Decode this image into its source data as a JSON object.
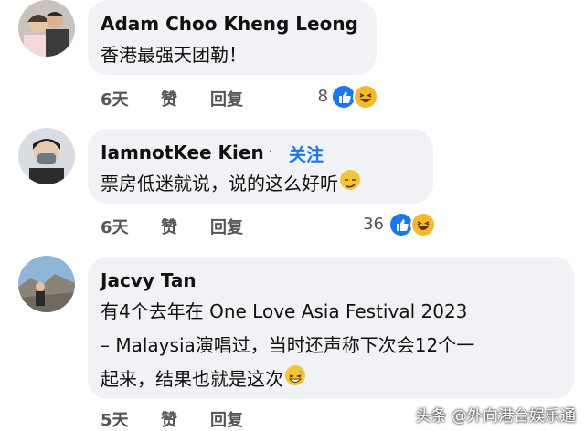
{
  "comments": [
    {
      "author": "Adam Choo Kheng Leong",
      "lines": [
        "香港最强天团勒！"
      ],
      "time": "6天",
      "like": "赞",
      "reply": "回复",
      "reaction_count": "8"
    },
    {
      "author": "IamnotKee Kien",
      "follow_dot": "·",
      "follow": "关注",
      "lines": [
        "票房低迷就说，说的这么好听"
      ],
      "time": "6天",
      "like": "赞",
      "reply": "回复",
      "reaction_count": "36"
    },
    {
      "author": "Jacvy Tan",
      "lines": [
        "有4个去年在 One Love Asia Festival 2023",
        "– Malaysia演唱过，当时还声称下次会12个一",
        "起来，结果也就是这次"
      ],
      "time": "5天",
      "like": "赞",
      "reply": "回复"
    }
  ],
  "reaction_icons": [
    "like-icon",
    "haha-icon"
  ],
  "colors": {
    "bubble": "#f0f2f5",
    "like": "#1877f2",
    "haha": "#f7b928",
    "link": "#1877f2"
  },
  "watermark": "头条 @外向港台娱乐通"
}
